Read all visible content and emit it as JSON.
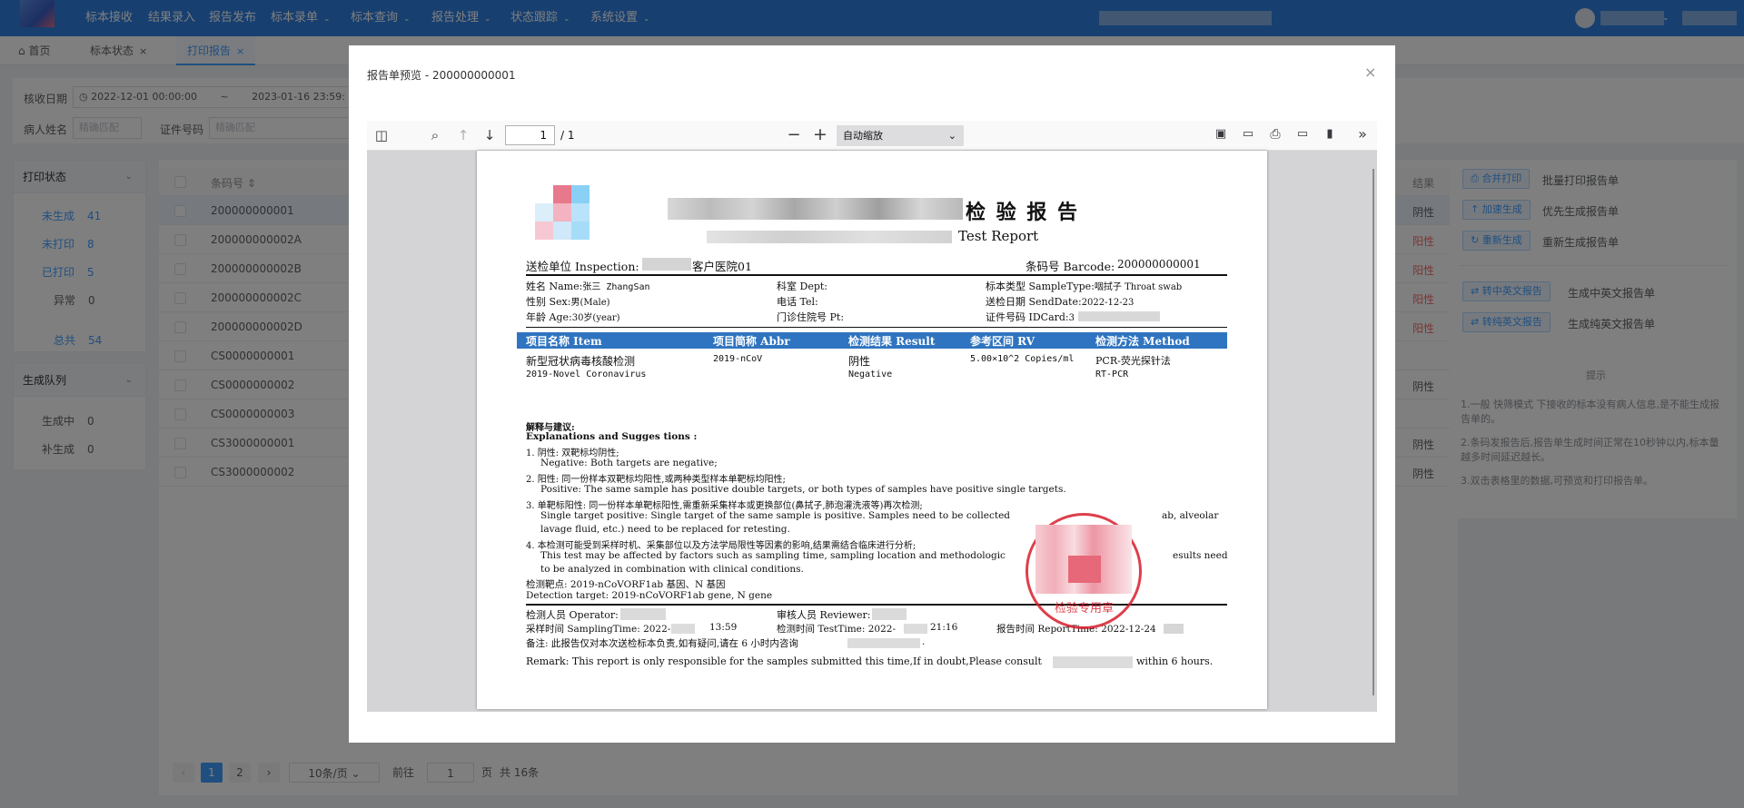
{
  "nav": {
    "items": [
      {
        "label": "标本接收",
        "chevron": false
      },
      {
        "label": "结果录入",
        "chevron": false
      },
      {
        "label": "报告发布",
        "chevron": false
      },
      {
        "label": "标本录单",
        "chevron": true
      },
      {
        "label": "标本查询",
        "chevron": true
      },
      {
        "label": "报告处理",
        "chevron": true
      },
      {
        "label": "状态跟踪",
        "chevron": true
      },
      {
        "label": "系统设置",
        "chevron": true
      }
    ]
  },
  "tabs": [
    {
      "label": "首页",
      "icon": "home-icon"
    },
    {
      "label": "标本状态",
      "closable": true
    },
    {
      "label": "打印报告",
      "closable": true,
      "active": true
    }
  ],
  "filter": {
    "receive_date_label": "核收日期",
    "date_start": "2022-12-01 00:00:00",
    "date_sep": "~",
    "date_end": "2023-01-16 23:59:",
    "patient_label": "病人姓名",
    "patient_placeholder": "精确匹配",
    "id_label": "证件号码",
    "id_placeholder": "精确匹配"
  },
  "print_status": {
    "title": "打印状态",
    "items": [
      {
        "label": "未生成",
        "count": "41",
        "highlight": true
      },
      {
        "label": "未打印",
        "count": "8",
        "highlight": true
      },
      {
        "label": "已打印",
        "count": "5",
        "highlight": true
      },
      {
        "label": "异常",
        "count": "0",
        "highlight": false
      },
      {
        "label": "总共",
        "count": "54",
        "highlight": true
      }
    ]
  },
  "queue": {
    "title": "生成队列",
    "items": [
      {
        "label": "生成中",
        "count": "0"
      },
      {
        "label": "补生成",
        "count": "0"
      }
    ]
  },
  "table": {
    "col_barcode": "条码号",
    "col_result": "结果",
    "rows": [
      {
        "barcode": "200000000001",
        "status": "阴性",
        "red": false,
        "selected": true
      },
      {
        "barcode": "200000000002A",
        "status": "阳性",
        "red": true
      },
      {
        "barcode": "200000000002B",
        "status": "阳性",
        "red": true
      },
      {
        "barcode": "200000000002C",
        "status": "阳性",
        "red": true
      },
      {
        "barcode": "200000000002D",
        "status": "阳性",
        "red": true
      },
      {
        "barcode": "CS0000000001",
        "status": "",
        "red": false
      },
      {
        "barcode": "CS0000000002",
        "status": "阴性",
        "red": false
      },
      {
        "barcode": "CS0000000003",
        "status": "",
        "red": false
      },
      {
        "barcode": "CS3000000001",
        "status": "阴性",
        "red": false
      },
      {
        "barcode": "CS3000000002",
        "status": "阴性",
        "red": false
      }
    ]
  },
  "actions": [
    {
      "button": "合并打印",
      "desc": "批量打印报告单",
      "icon": "printer-icon"
    },
    {
      "button": "加速生成",
      "desc": "优先生成报告单",
      "icon": "bolt-icon"
    },
    {
      "button": "重新生成",
      "desc": "重新生成报告单",
      "icon": "refresh-icon"
    },
    {
      "button": "转中英文报告",
      "desc": "生成中英文报告单",
      "icon": "translate-icon"
    },
    {
      "button": "转纯英文报告",
      "desc": "生成纯英文报告单",
      "icon": "translate-icon"
    }
  ],
  "tips": {
    "title": "提示",
    "lines": [
      "1.一般 快筛模式 下接收的标本没有病人信息,是不能生成报告单的。",
      "2.条码发报告后,报告单生成时间正常在10秒钟以内,标本量越多时间延迟越长。",
      "3.双击表格里的数据,可预览和打印报告单。"
    ]
  },
  "pagination": {
    "pages": [
      "1",
      "2"
    ],
    "page_size": "10条/页",
    "goto_label": "前往",
    "goto_value": "1",
    "page_unit": "页",
    "total": "共 16条"
  },
  "dialog": {
    "title": "报告单预览 - 200000000001",
    "close": "×",
    "pdf": {
      "page_value": "1",
      "page_total": "/ 1",
      "zoom": "自动缩放"
    }
  },
  "report": {
    "title": "检 验 报 告",
    "title_en": "Test Report",
    "inspection_label": "送检单位 Inspection:",
    "inspection_value": "客户医院01",
    "barcode_label": "条码号 Barcode:",
    "barcode_value": "200000000001",
    "name": "姓名 Name:",
    "name_value": "张三 ZhangSan",
    "dept": "科室 Dept:",
    "sample_type": "标本类型 SampleType:",
    "sample_type_value": "咽拭子 Throat swab",
    "sex": "性别 Sex:",
    "sex_value": "男(Male)",
    "tel": "电话 Tel:",
    "send_date": "送检日期 SendDate:",
    "send_date_value": "2022-12-23",
    "age": "年龄 Age:",
    "age_value": "30岁(year)",
    "pt": "门诊住院号 Pt:",
    "idcard": "证件号码 IDCard:",
    "idcard_value": "3",
    "headers": [
      "项目名称 Item",
      "项目简称 Abbr",
      "检测结果 Result",
      "参考区间 RV",
      "检测方法 Method"
    ],
    "item_cn": "新型冠状病毒核酸检测",
    "item_en": "2019-Novel Coronavirus",
    "abbr": "2019-nCoV",
    "result_cn": "阴性",
    "result_en": "Negative",
    "rv": "5.00×10^2 Copies/ml",
    "method_cn": "PCR-荧光探针法",
    "method_en": "RT-PCR",
    "explain_cn": "解释与建议:",
    "explain_en": "Explanations and Sugges tions :",
    "e1_cn": "1. 阴性: 双靶标均阴性;",
    "e1_en": "Negative:  Both targets are negative;",
    "e2_cn": "2. 阳性: 同一份样本双靶标均阳性,或两种类型样本单靶标均阳性;",
    "e2_en": "Positive:  The same sample has positive double targets, or both types of samples have positive single targets.",
    "e3_cn": "3. 单靶标阳性: 同一份样本单靶标阳性,需重新采集样本或更换部位(鼻拭子,肺泡灌洗液等)再次检测;",
    "e3_en1": "Single target positive:  Single target of the same sample is positive. Samples need to be collected",
    "e3_en1b": "ab, alveolar",
    "e3_en2": "lavage fluid, etc.) need to be replaced for retesting.",
    "e4_cn": "4. 本检测可能受到采样时机、采集部位以及方法学局限性等因素的影响,结果需结合临床进行分析;",
    "e4_en1": "This test may be affected by factors such as sampling time, sampling location and methodologic",
    "e4_en1b": "esults need",
    "e4_en2": "to be analyzed in combination with clinical conditions.",
    "target_cn": "检测靶点: 2019-nCoVORF1ab 基因、N 基因",
    "target_en": "Detection target: 2019-nCoVORF1ab gene, N gene",
    "operator": "检测人员 Operator:",
    "reviewer": "审核人员 Reviewer:",
    "sampling": "采样时间 SamplingTime: 2022-",
    "sampling_tail": "13:59",
    "testtime": "检测时间 TestTime: 2022-",
    "testtime_tail": "21:16",
    "reporttime": "报告时间 ReportTime: 2022-12-24",
    "note": "备注: 此报告仅对本次送检标本负责,如有疑问,请在 6 小时内咨询",
    "remark": "Remark: This report is only responsible for the samples submitted this time,If in doubt,Please consult",
    "remark_tail": "within 6 hours.",
    "stamp": "检验专用章"
  },
  "colors": {
    "primary": "#2f7fe0",
    "accent": "#409eff",
    "table_header": "#2f74c0",
    "positive": "#f56c6c",
    "stamp": "#d81e2c"
  }
}
